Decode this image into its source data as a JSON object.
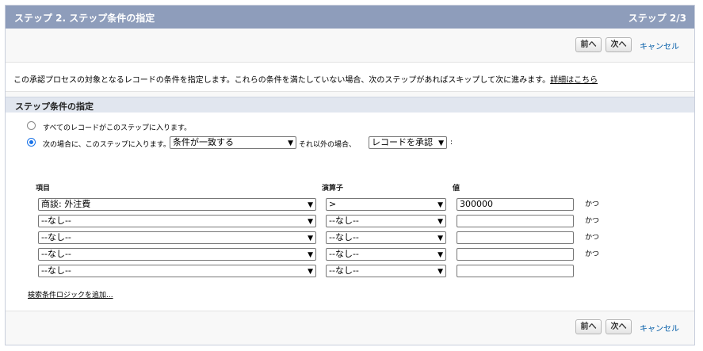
{
  "header": {
    "title": "ステップ 2. ステップ条件の指定",
    "step": "ステップ 2/3"
  },
  "buttons": {
    "prev": "前へ",
    "next": "次へ",
    "cancel": "キャンセル"
  },
  "description": {
    "text": "この承認プロセスの対象となるレコードの条件を指定します。これらの条件を満たしていない場合、次のステップがあればスキップして次に進みます。",
    "link": "詳細はこちら"
  },
  "section": {
    "title": "ステップ条件の指定"
  },
  "radios": {
    "all": "すべてのレコードがこのステップに入ります。",
    "conditional": "次の場合に、このステップに入ります。"
  },
  "criteria_select": "条件が一致する",
  "otherwise_label": "それ以外の場合、",
  "otherwise_select": "レコードを承認",
  "colon": ":",
  "columns": {
    "field": "項目",
    "operator": "演算子",
    "value": "値"
  },
  "rows": [
    {
      "field": "商談: 外注費",
      "operator": ">",
      "value": "300000",
      "suffix": "かつ"
    },
    {
      "field": "--なし--",
      "operator": "--なし--",
      "value": "",
      "suffix": "かつ"
    },
    {
      "field": "--なし--",
      "operator": "--なし--",
      "value": "",
      "suffix": "かつ"
    },
    {
      "field": "--なし--",
      "operator": "--なし--",
      "value": "",
      "suffix": "かつ"
    },
    {
      "field": "--なし--",
      "operator": "--なし--",
      "value": "",
      "suffix": ""
    }
  ],
  "add_logic_link": "検索条件ロジックを追加..."
}
